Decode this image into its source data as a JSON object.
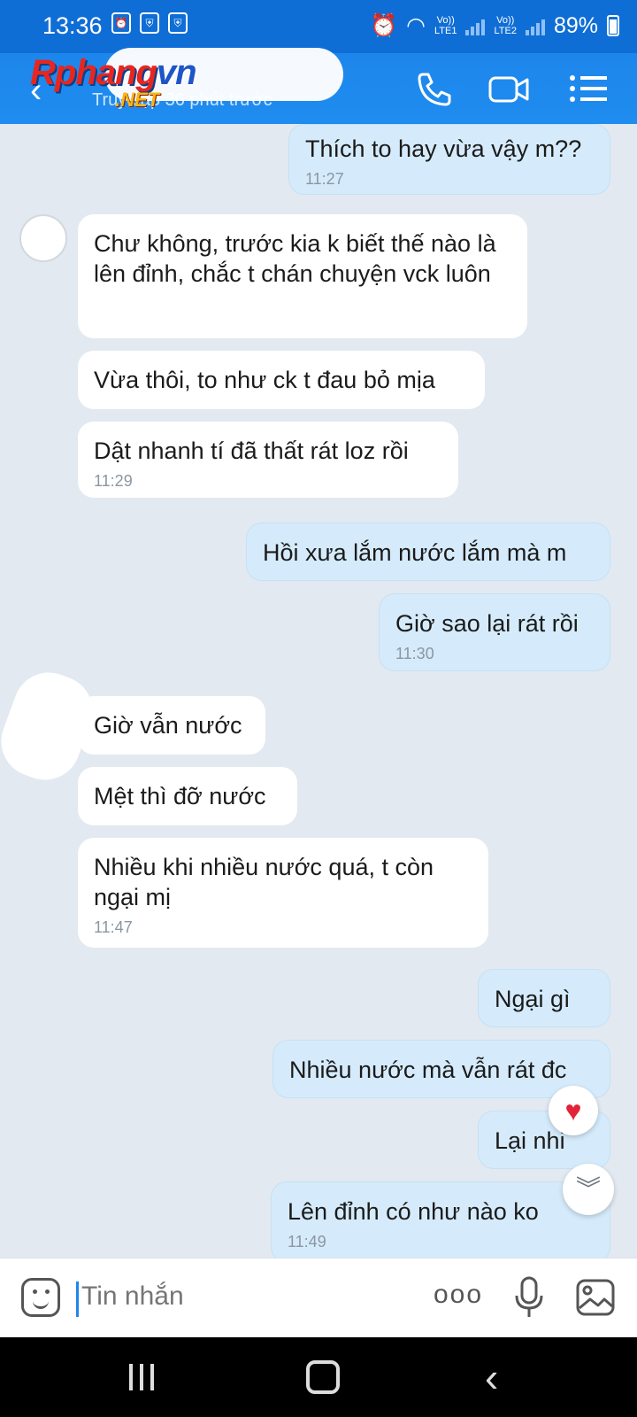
{
  "status_bar": {
    "time": "13:36",
    "lte1": "Vo))\nLTE1",
    "lte2": "Vo))\nLTE2",
    "battery": "89%"
  },
  "header": {
    "contact_name": "",
    "last_seen": "Truy cập 36 phút trước",
    "watermark_main": "Rphang",
    "watermark_accent": "vn",
    "watermark_sub": ".NET",
    "accent_color": "#1f8cef"
  },
  "messages": [
    {
      "side": "out",
      "text": "Thích to hay vừa vậy m??",
      "time": "11:27"
    },
    {
      "side": "in",
      "text": "Chư không, trước kia k biết thế nào là lên đỉnh, chắc t chán chuyện vck luôn",
      "time": ""
    },
    {
      "side": "in",
      "text": "Vừa thôi, to như ck t đau bỏ mịa",
      "time": ""
    },
    {
      "side": "in",
      "text": "Dật nhanh tí đã thất rát loz rồi",
      "time": "11:29"
    },
    {
      "side": "out",
      "text": "Hồi xưa lắm nước lắm mà m",
      "time": ""
    },
    {
      "side": "out",
      "text": "Giờ sao lại rát rồi",
      "time": "11:30"
    },
    {
      "side": "in",
      "text": "Giờ vẫn nước",
      "time": ""
    },
    {
      "side": "in",
      "text": "Mệt thì đỡ nước",
      "time": ""
    },
    {
      "side": "in",
      "text": "Nhiều khi nhiều nước quá, t còn ngại mị",
      "time": "11:47"
    },
    {
      "side": "out",
      "text": "Ngại gì",
      "time": ""
    },
    {
      "side": "out",
      "text": "Nhiều nước mà vẫn rát đc",
      "time": ""
    },
    {
      "side": "out",
      "text": "Lại nhi",
      "time": ""
    },
    {
      "side": "out",
      "text": "Lên đỉnh có như nào ko",
      "time": "11:49"
    }
  ],
  "reaction": "heart-icon",
  "input": {
    "placeholder": "Tin nhắn",
    "more": "ooo"
  }
}
